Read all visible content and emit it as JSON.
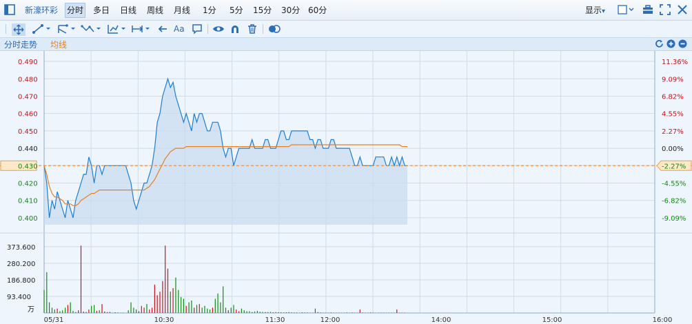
{
  "toolbar": {
    "stock_name": "新濠环彩",
    "periods": [
      "分时",
      "多日",
      "日线",
      "周线",
      "月线",
      "1分",
      "5分",
      "15分",
      "30分",
      "60分"
    ],
    "active_period": "分时",
    "display_label": "显示",
    "display_arrow": "▾"
  },
  "drawtools": {
    "text_tool": "Aa"
  },
  "legend": {
    "title": "分时走势",
    "avg_label": "均线",
    "avg_color": "#e8801e",
    "price_color": "#1e7fd0"
  },
  "colors": {
    "up": "#d0101a",
    "down": "#108a10",
    "flat": "#222222",
    "ref_line": "#e8801e"
  },
  "price_axis": {
    "labels": [
      "0.490",
      "0.480",
      "0.470",
      "0.460",
      "0.450",
      "0.440",
      "0.430",
      "0.420",
      "0.410",
      "0.400"
    ],
    "current_label": "0.430"
  },
  "pct_axis": {
    "labels": [
      "11.36%",
      "9.09%",
      "6.82%",
      "4.55%",
      "2.27%",
      "0.00%",
      "-2.27%",
      "-4.55%",
      "-6.82%",
      "-9.09%"
    ],
    "current_label": "-2.27%"
  },
  "volume_axis": {
    "labels": [
      "373.600",
      "280.200",
      "186.800",
      "93.400"
    ],
    "unit": "万"
  },
  "time_axis": {
    "labels": [
      "05/31",
      "10:30",
      "11:30",
      "12:00",
      "14:00",
      "15:00",
      "16:00"
    ]
  },
  "chart_data": {
    "type": "line",
    "title": "分时走势",
    "ylim": [
      0.396,
      0.492
    ],
    "reference_price": 0.44,
    "session_minutes": 390,
    "series": [
      {
        "name": "分时走势",
        "values": [
          0.43,
          0.42,
          0.4,
          0.41,
          0.405,
          0.415,
          0.41,
          0.405,
          0.4,
          0.41,
          0.405,
          0.4,
          0.41,
          0.415,
          0.42,
          0.425,
          0.425,
          0.435,
          0.43,
          0.42,
          0.43,
          0.43,
          0.425,
          0.43,
          0.43,
          0.43,
          0.43,
          0.43,
          0.43,
          0.43,
          0.43,
          0.43,
          0.425,
          0.42,
          0.41,
          0.405,
          0.41,
          0.415,
          0.42,
          0.42,
          0.425,
          0.43,
          0.44,
          0.455,
          0.46,
          0.47,
          0.475,
          0.48,
          0.475,
          0.478,
          0.47,
          0.465,
          0.46,
          0.455,
          0.46,
          0.455,
          0.45,
          0.46,
          0.455,
          0.46,
          0.46,
          0.455,
          0.45,
          0.45,
          0.455,
          0.455,
          0.455,
          0.45,
          0.44,
          0.435,
          0.44,
          0.44,
          0.43,
          0.435,
          0.44,
          0.44,
          0.44,
          0.44,
          0.44,
          0.445,
          0.44,
          0.44,
          0.44,
          0.44,
          0.445,
          0.445,
          0.44,
          0.44,
          0.44,
          0.445,
          0.45,
          0.45,
          0.445,
          0.445,
          0.45,
          0.45,
          0.45,
          0.45,
          0.45,
          0.45,
          0.45,
          0.445,
          0.445,
          0.44,
          0.445,
          0.445,
          0.44,
          0.44,
          0.44,
          0.445,
          0.445,
          0.44,
          0.44,
          0.44,
          0.44,
          0.44,
          0.44,
          0.435,
          0.43,
          0.43,
          0.435,
          0.43,
          0.43,
          0.43,
          0.43,
          0.43,
          0.435,
          0.435,
          0.435,
          0.435,
          0.43,
          0.43,
          0.435,
          0.43,
          0.435,
          0.43,
          0.435,
          0.43,
          0.43
        ]
      },
      {
        "name": "均线",
        "values": [
          0.43,
          0.425,
          0.418,
          0.414,
          0.412,
          0.412,
          0.411,
          0.41,
          0.408,
          0.408,
          0.408,
          0.407,
          0.407,
          0.408,
          0.41,
          0.411,
          0.412,
          0.413,
          0.414,
          0.414,
          0.415,
          0.416,
          0.416,
          0.416,
          0.416,
          0.416,
          0.416,
          0.416,
          0.416,
          0.416,
          0.416,
          0.416,
          0.416,
          0.416,
          0.416,
          0.416,
          0.416,
          0.416,
          0.416,
          0.417,
          0.418,
          0.42,
          0.422,
          0.425,
          0.428,
          0.431,
          0.434,
          0.436,
          0.438,
          0.439,
          0.44,
          0.44,
          0.44,
          0.44,
          0.441,
          0.441,
          0.441,
          0.441,
          0.441,
          0.441,
          0.441,
          0.441,
          0.441,
          0.441,
          0.441,
          0.441,
          0.441,
          0.441,
          0.441,
          0.441,
          0.441,
          0.441,
          0.441,
          0.441,
          0.441,
          0.441,
          0.441,
          0.441,
          0.441,
          0.441,
          0.441,
          0.441,
          0.441,
          0.441,
          0.441,
          0.441,
          0.441,
          0.441,
          0.441,
          0.441,
          0.441,
          0.441,
          0.441,
          0.441,
          0.442,
          0.442,
          0.442,
          0.442,
          0.442,
          0.442,
          0.442,
          0.442,
          0.442,
          0.442,
          0.442,
          0.442,
          0.442,
          0.442,
          0.442,
          0.442,
          0.442,
          0.442,
          0.442,
          0.442,
          0.442,
          0.442,
          0.442,
          0.442,
          0.442,
          0.442,
          0.442,
          0.442,
          0.442,
          0.442,
          0.442,
          0.442,
          0.442,
          0.442,
          0.442,
          0.442,
          0.442,
          0.442,
          0.442,
          0.442,
          0.442,
          0.442,
          0.441,
          0.441,
          0.441
        ]
      }
    ],
    "volume": {
      "ylim": [
        0,
        420
      ],
      "values": [
        130,
        230,
        60,
        30,
        20,
        25,
        10,
        15,
        30,
        45,
        60,
        12,
        5,
        15,
        380,
        8,
        6,
        20,
        40,
        45,
        12,
        15,
        50,
        8,
        5,
        6,
        2,
        4,
        3,
        1,
        2,
        0,
        15,
        60,
        30,
        20,
        10,
        40,
        30,
        50,
        20,
        30,
        160,
        100,
        120,
        180,
        380,
        250,
        120,
        140,
        200,
        130,
        90,
        80,
        40,
        60,
        70,
        30,
        45,
        50,
        30,
        40,
        25,
        20,
        30,
        80,
        110,
        60,
        150,
        30,
        15,
        30,
        45,
        20,
        10,
        25,
        15,
        10,
        10,
        5,
        8,
        12,
        7,
        6,
        5,
        5,
        6,
        4,
        5,
        4,
        4,
        3,
        4,
        5,
        3,
        3,
        3,
        2,
        4,
        3,
        3,
        2,
        2,
        25,
        5,
        3,
        2,
        2,
        2,
        3,
        2,
        2,
        2,
        2,
        2,
        3,
        2,
        3,
        2,
        2,
        20,
        3,
        2,
        2,
        3,
        2,
        1,
        2,
        2,
        2,
        2,
        2,
        2,
        2,
        20,
        2,
        2,
        2
      ],
      "directions": [
        "d",
        "d",
        "d",
        "d",
        "d",
        "u",
        "d",
        "d",
        "d",
        "u",
        "d",
        "d",
        "u",
        "u",
        "u",
        "u",
        "d",
        "u",
        "d",
        "d",
        "u",
        "d",
        "u",
        "u",
        "d",
        "u",
        "d",
        "u",
        "d",
        "u",
        "d",
        "d",
        "d",
        "d",
        "d",
        "d",
        "u",
        "u",
        "u",
        "d",
        "u",
        "u",
        "u",
        "u",
        "u",
        "u",
        "u",
        "u",
        "d",
        "u",
        "d",
        "d",
        "d",
        "d",
        "u",
        "d",
        "d",
        "u",
        "d",
        "u",
        "d",
        "d",
        "d",
        "d",
        "u",
        "d",
        "d",
        "d",
        "d",
        "d",
        "u",
        "d",
        "d",
        "u",
        "u",
        "d",
        "d",
        "d",
        "d",
        "u",
        "d",
        "d",
        "d",
        "d",
        "u",
        "d",
        "d",
        "d",
        "d",
        "u",
        "u",
        "d",
        "d",
        "d",
        "u",
        "d",
        "d",
        "d",
        "d",
        "d",
        "d",
        "d",
        "d",
        "d",
        "u",
        "d",
        "d",
        "d",
        "d",
        "u",
        "d",
        "d",
        "d",
        "d",
        "d",
        "d",
        "d",
        "d",
        "d",
        "d",
        "u",
        "d",
        "d",
        "d",
        "d",
        "d",
        "u",
        "d",
        "d",
        "d",
        "d",
        "d",
        "u",
        "d",
        "u",
        "d",
        "d",
        "d",
        "d"
      ]
    }
  }
}
